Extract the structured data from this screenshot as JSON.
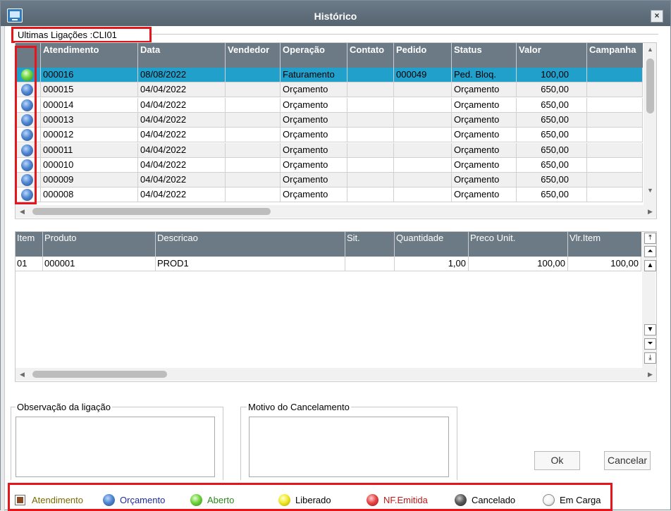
{
  "window": {
    "title": "Histórico",
    "close_label": "×"
  },
  "history_group": {
    "title": "Ultimas Ligações :CLI01"
  },
  "calls_table": {
    "columns": [
      "",
      "Atendimento",
      "Data",
      "Vendedor",
      "Operação",
      "Contato",
      "Pedido",
      "Status",
      "Valor",
      "Campanha"
    ],
    "rows": [
      {
        "status_icon": "green-orb-icon",
        "atendimento": "000016",
        "data": "08/08/2022",
        "vendedor": "",
        "operacao": "Faturamento",
        "contato": "",
        "pedido": "000049",
        "status": "Ped. Bloq.",
        "valor": "100,00",
        "campanha": ""
      },
      {
        "status_icon": "blue-orb-icon",
        "atendimento": "000015",
        "data": "04/04/2022",
        "vendedor": "",
        "operacao": "Orçamento",
        "contato": "",
        "pedido": "",
        "status": "Orçamento",
        "valor": "650,00",
        "campanha": ""
      },
      {
        "status_icon": "blue-orb-icon",
        "atendimento": "000014",
        "data": "04/04/2022",
        "vendedor": "",
        "operacao": "Orçamento",
        "contato": "",
        "pedido": "",
        "status": "Orçamento",
        "valor": "650,00",
        "campanha": ""
      },
      {
        "status_icon": "blue-orb-icon",
        "atendimento": "000013",
        "data": "04/04/2022",
        "vendedor": "",
        "operacao": "Orçamento",
        "contato": "",
        "pedido": "",
        "status": "Orçamento",
        "valor": "650,00",
        "campanha": ""
      },
      {
        "status_icon": "blue-orb-icon",
        "atendimento": "000012",
        "data": "04/04/2022",
        "vendedor": "",
        "operacao": "Orçamento",
        "contato": "",
        "pedido": "",
        "status": "Orçamento",
        "valor": "650,00",
        "campanha": ""
      },
      {
        "status_icon": "blue-orb-icon",
        "atendimento": "000011",
        "data": "04/04/2022",
        "vendedor": "",
        "operacao": "Orçamento",
        "contato": "",
        "pedido": "",
        "status": "Orçamento",
        "valor": "650,00",
        "campanha": ""
      },
      {
        "status_icon": "blue-orb-icon",
        "atendimento": "000010",
        "data": "04/04/2022",
        "vendedor": "",
        "operacao": "Orçamento",
        "contato": "",
        "pedido": "",
        "status": "Orçamento",
        "valor": "650,00",
        "campanha": ""
      },
      {
        "status_icon": "blue-orb-icon",
        "atendimento": "000009",
        "data": "04/04/2022",
        "vendedor": "",
        "operacao": "Orçamento",
        "contato": "",
        "pedido": "",
        "status": "Orçamento",
        "valor": "650,00",
        "campanha": ""
      },
      {
        "status_icon": "blue-orb-icon",
        "atendimento": "000008",
        "data": "04/04/2022",
        "vendedor": "",
        "operacao": "Orçamento",
        "contato": "",
        "pedido": "",
        "status": "Orçamento",
        "valor": "650,00",
        "campanha": ""
      }
    ]
  },
  "items_table": {
    "columns": [
      "Item",
      "Produto",
      "Descricao",
      "Sit.",
      "Quantidade",
      "Preco Unit.",
      "Vlr.Item"
    ],
    "rows": [
      {
        "item": "01",
        "produto": "000001",
        "descricao": "PROD1",
        "sit": "",
        "quantidade": "1,00",
        "preco_unit": "100,00",
        "vlr_item": "100,00"
      }
    ]
  },
  "observacao": {
    "label": "Observação da ligação",
    "value": ""
  },
  "motivo_cancelamento": {
    "label": "Motivo do Cancelamento",
    "value": ""
  },
  "buttons": {
    "ok": "Ok",
    "cancelar": "Cancelar"
  },
  "legend": [
    {
      "icon": "brown-square-icon",
      "label": "Atendimento",
      "color": "#7a6a00"
    },
    {
      "icon": "blue-orb-icon",
      "label": "Orçamento",
      "color": "#1f2aa0"
    },
    {
      "icon": "green-orb-icon",
      "label": "Aberto",
      "color": "#2a8a1a"
    },
    {
      "icon": "yellow-orb-icon",
      "label": "Liberado",
      "color": "#000000"
    },
    {
      "icon": "red-orb-icon",
      "label": "NF.Emitida",
      "color": "#c01818"
    },
    {
      "icon": "dark-orb-icon",
      "label": "Cancelado",
      "color": "#000000"
    },
    {
      "icon": "white-orb-icon",
      "label": "Em Carga",
      "color": "#000000"
    }
  ],
  "colors": {
    "titlebar": "#5f6e7a",
    "header": "#6b7a85",
    "selected_row": "#21a0cc",
    "highlight": "#e6141b"
  }
}
